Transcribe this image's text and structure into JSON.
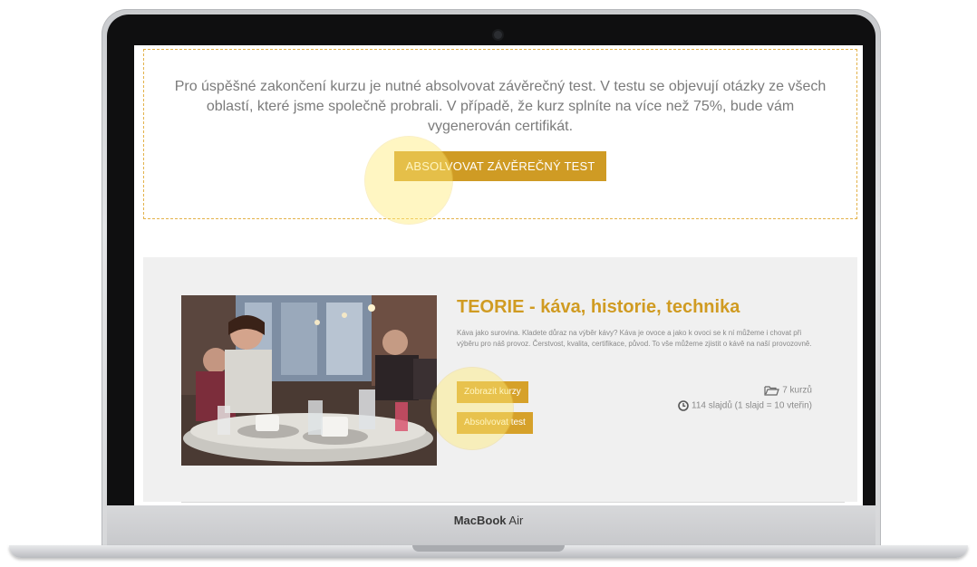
{
  "device": {
    "brand": "MacBook",
    "model": "Air"
  },
  "test_section": {
    "text": "Pro úspěšné zakončení kurzu je nutné absolvovat závěrečný test. V testu se objevují otázky ze všech oblastí, které jsme společně probrali. V případě, že kurz splníte na více než 75%, bude vám vygenerován certifikát.",
    "button_label": "ABSOLVOVAT ZÁVĚREČNÝ TEST"
  },
  "course": {
    "title": "TEORIE - káva, historie, technika",
    "description": "Káva jako surovina. Kladete důraz na výběr kávy? Káva je ovoce a jako k ovoci se k ní můžeme i chovat při výběru pro náš provoz. Čerstvost, kvalita, certifikace, původ. To vše můžeme zjistit o kávě na naší provozovně.",
    "show_button": "Zobrazit kurzy",
    "exam_button": "Absolvovat test",
    "course_count": "7 kurzů",
    "slides_info": "114 slajdů (1 slajd = 10 vteřin)"
  },
  "colors": {
    "accent": "#cf9b24",
    "title": "#d09b22",
    "panel_bg": "#f0f0f0",
    "border": "#e3b24a"
  },
  "icons": [
    "folder-icon",
    "clock-icon"
  ]
}
